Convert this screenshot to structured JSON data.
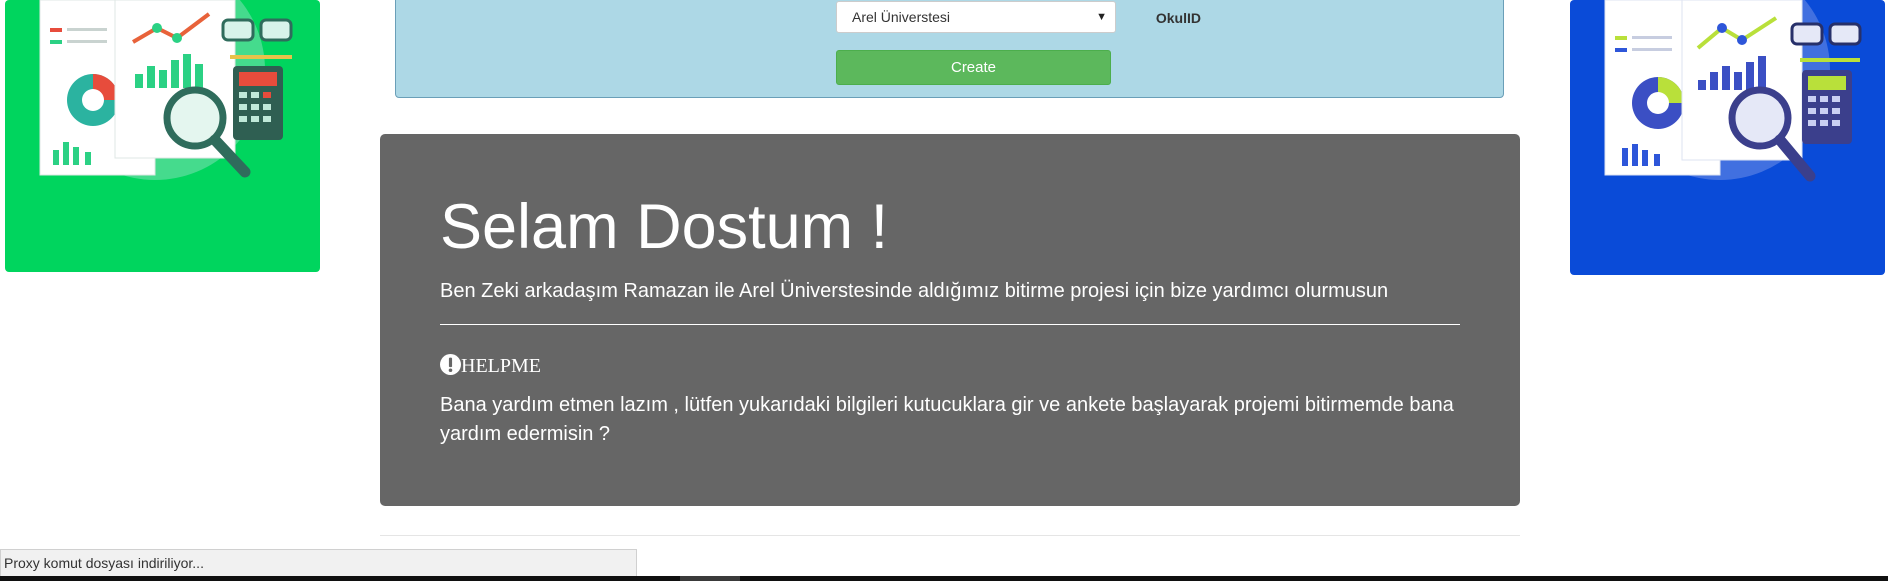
{
  "form": {
    "okul_label": "OkulID",
    "okul_selected": "Arel Üniverstesi",
    "create_label": "Create"
  },
  "jumbotron": {
    "title": "Selam Dostum !",
    "lead": "Ben Zeki arkadaşım Ramazan ile Arel Üniverstesinde aldığımız bitirme projesi için bize yardımcı olurmusun",
    "help_heading": "HELPME",
    "body": "Bana yardım etmen lazım , lütfen yukarıdaki bilgileri kutucuklara gir ve ankete başlayarak projemi bitirmemde bana yardım edermisin ?"
  },
  "status": {
    "text": "Proxy komut dosyası indiriliyor..."
  },
  "icons": {
    "select_arrow": "dropdown-arrow-icon",
    "help": "exclamation-circle-icon",
    "left_art": "analytics-report-illustration",
    "right_art": "analytics-report-illustration"
  },
  "colors": {
    "form_bg": "#add8e6",
    "create_button": "#5cb85c",
    "jumbotron_bg": "#666666",
    "left_card": "#00d55e",
    "right_card": "#0a4bd8"
  }
}
